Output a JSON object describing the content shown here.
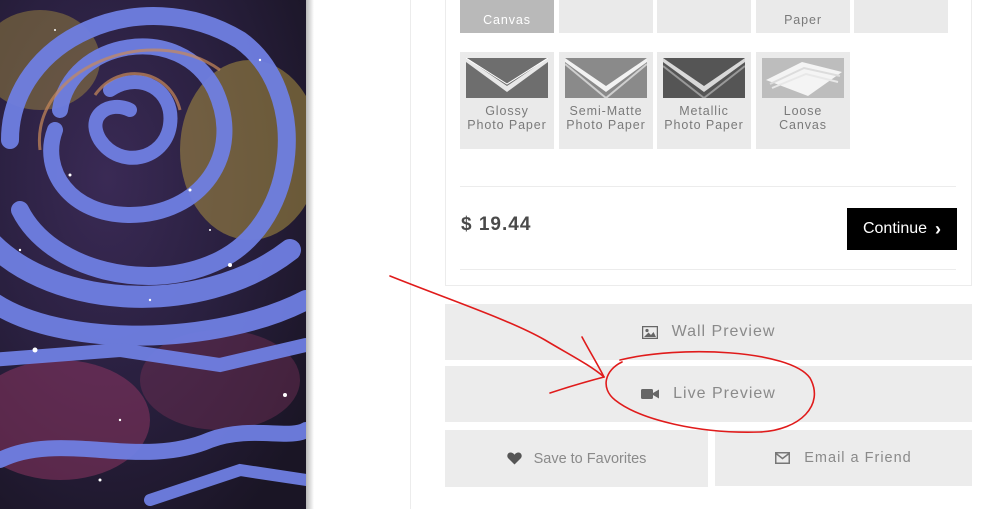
{
  "artwork": {
    "colors": {
      "blue": "#6f7fe2",
      "gold": "#b79b45",
      "magenta": "#9b3f6d",
      "dark": "#1b1730"
    }
  },
  "media_options": {
    "row1": [
      {
        "label": "Canvas",
        "selected": true
      },
      {
        "label": "",
        "selected": false
      },
      {
        "label": "",
        "selected": false
      },
      {
        "label": "Paper",
        "selected": false
      },
      {
        "label": "",
        "selected": false
      }
    ],
    "row2": [
      {
        "line1": "Glossy",
        "line2": "Photo Paper",
        "icon": "glossy-paper-icon"
      },
      {
        "line1": "Semi-Matte",
        "line2": "Photo Paper",
        "icon": "semi-matte-paper-icon"
      },
      {
        "line1": "Metallic",
        "line2": "Photo Paper",
        "icon": "metallic-paper-icon"
      },
      {
        "line1": "Loose",
        "line2": "Canvas",
        "icon": "loose-canvas-icon"
      }
    ]
  },
  "price": "$ 19.44",
  "continue_label": "Continue",
  "actions": {
    "wall_preview": "Wall Preview",
    "live_preview": "Live Preview",
    "save_favorites": "Save to Favorites",
    "email_friend": "Email a Friend"
  },
  "colors": {
    "button_bg": "#ececec",
    "button_text": "#8a8a8a",
    "continue_bg": "#000000",
    "annotation": "#e01b1b"
  }
}
